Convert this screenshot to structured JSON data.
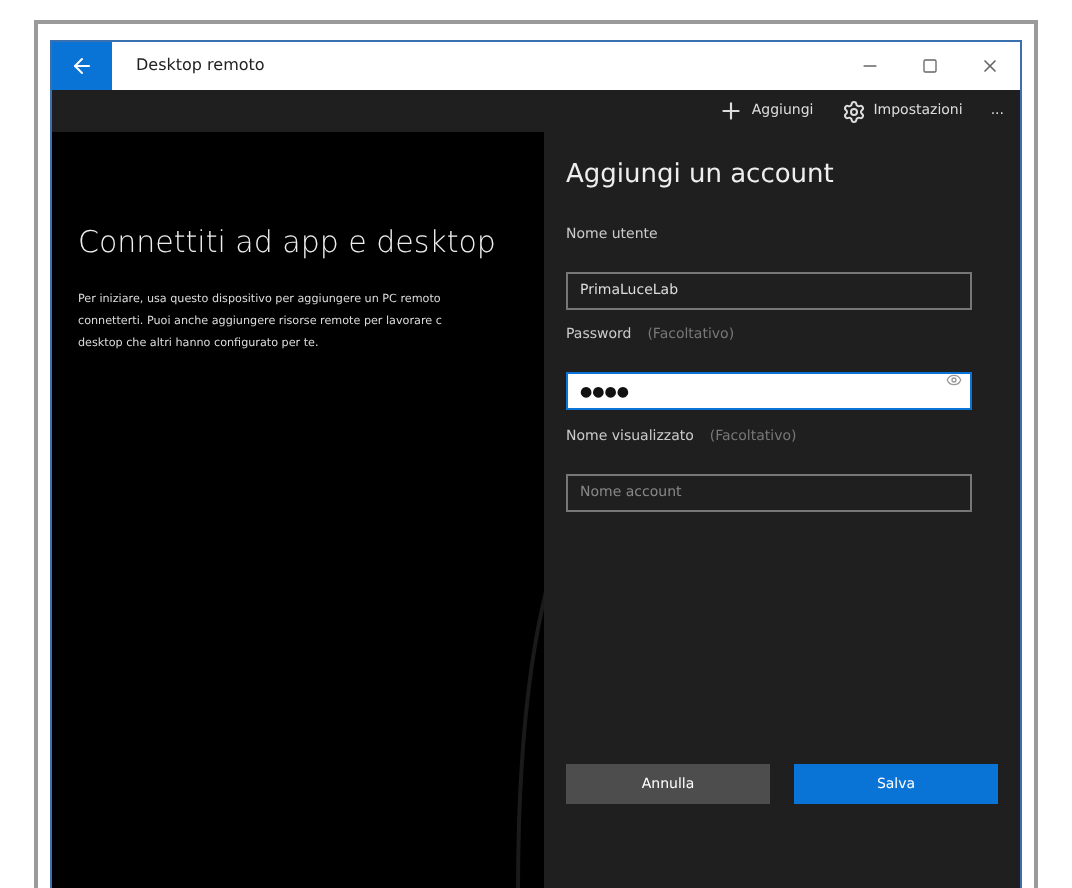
{
  "window": {
    "title": "Desktop remoto"
  },
  "toolbar": {
    "items": [
      {
        "kind": "add",
        "label": "Aggiungi"
      },
      {
        "kind": "settings",
        "label": "Impostazioni"
      },
      {
        "kind": "more",
        "label": "..."
      }
    ]
  },
  "intro": {
    "heading": "Connettiti ad app e desktop",
    "lines": [
      "Per iniziare, usa questo dispositivo per aggiungere un PC remoto",
      "connetterti. Puoi anche aggiungere risorse remote per lavorare c",
      "desktop che altri hanno configurato per te."
    ]
  },
  "panel": {
    "title": "Aggiungi un account",
    "fields": [
      {
        "label": "Nome utente",
        "value": "PrimaLuceLab",
        "focused": false
      },
      {
        "label": "Password",
        "hint": "(Facoltativo)",
        "value": "●●●●",
        "focused": true,
        "reveal": true
      },
      {
        "label": "Nome visualizzato",
        "hint": "(Facoltativo)",
        "placeholder": "Nome account",
        "focused": false
      }
    ],
    "buttons": [
      {
        "label": "Annulla",
        "kind": "secondary"
      },
      {
        "label": "Salva",
        "kind": "primary"
      }
    ]
  }
}
